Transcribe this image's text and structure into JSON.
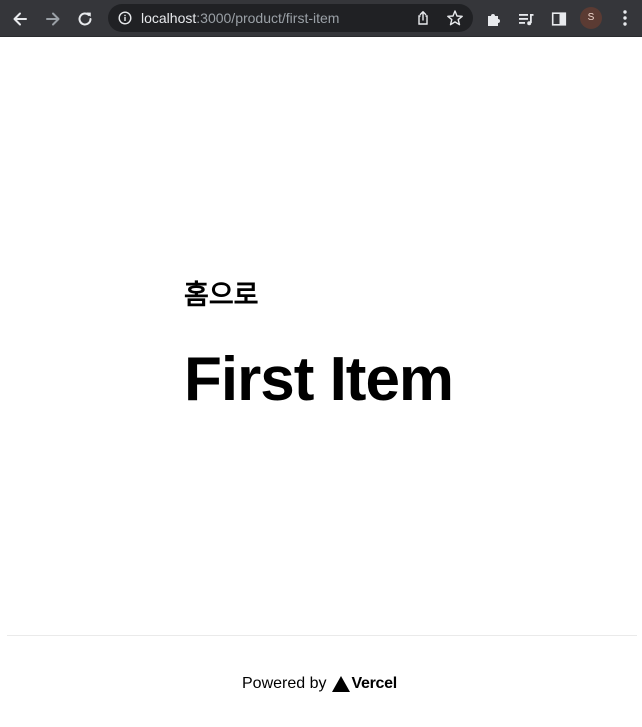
{
  "browser": {
    "url_host": "localhost",
    "url_path": ":3000/product/first-item",
    "avatar_initial": "S",
    "colors": {
      "toolbar_bg": "#35363a",
      "omnibox_bg": "#202124",
      "icon": "#e8eaed"
    },
    "icons": {
      "back": "arrow-left-icon",
      "forward": "arrow-right-icon",
      "reload": "reload-icon",
      "site_info": "info-icon",
      "share": "share-icon",
      "bookmark": "star-icon",
      "extensions": "puzzle-icon",
      "media": "media-queue-icon",
      "side_panel": "side-panel-icon",
      "menu": "kebab-menu-icon"
    }
  },
  "page": {
    "home_link": "홈으로",
    "title": "First Item",
    "footer": {
      "powered_by": "Powered by",
      "vercel_logo_text": "Vercel"
    }
  }
}
